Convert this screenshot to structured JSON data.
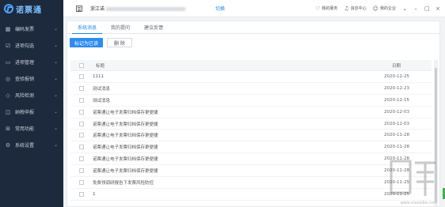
{
  "app": {
    "name": "诺票通"
  },
  "sidebar": {
    "items": [
      {
        "label": "编码发票",
        "icon": "barcode-icon"
      },
      {
        "label": "进项勾选",
        "icon": "checklist-icon"
      },
      {
        "label": "进项管理",
        "icon": "folder-icon"
      },
      {
        "label": "查验报销",
        "icon": "verify-icon"
      },
      {
        "label": "风险检测",
        "icon": "risk-icon"
      },
      {
        "label": "纳税申报",
        "icon": "tax-icon"
      },
      {
        "label": "常用功能",
        "icon": "grid-icon"
      },
      {
        "label": "系统设置",
        "icon": "gear-icon"
      }
    ]
  },
  "topbar": {
    "company_prefix": "浙江诺",
    "switch_label": "切换",
    "service_label": "我的服务",
    "message_label": "消息中心",
    "enterprise_label": "我的企业"
  },
  "tabs": [
    {
      "label": "系统消息",
      "active": true
    },
    {
      "label": "我的提问",
      "active": false
    },
    {
      "label": "建议反馈",
      "active": false
    }
  ],
  "toolbar": {
    "mark_read_label": "标记为已读",
    "delete_label": "删 除"
  },
  "table": {
    "headers": {
      "title": "标题",
      "date": "日期"
    },
    "rows": [
      {
        "title": "1111",
        "date": "2020-12-25"
      },
      {
        "title": "测试消息",
        "date": "2020-12-23"
      },
      {
        "title": "测试消息",
        "date": "2020-12-15"
      },
      {
        "title": "诺票通让电子发票归档保存更便捷",
        "date": "2020-12-03"
      },
      {
        "title": "诺票通让电子发票归档保存更便捷",
        "date": "2020-12-03"
      },
      {
        "title": "诺票通让电子发票归档保存更便捷",
        "date": "2020-11-28"
      },
      {
        "title": "诺票通让电子发票归档保存更便捷",
        "date": "2020-11-28"
      },
      {
        "title": "诺票通让电子发票归档保存更便捷",
        "date": "2020-11-28"
      },
      {
        "title": "诺票通让电子发票归档保存更便捷",
        "date": "2020-11-28"
      },
      {
        "title": "免费领调研报告下发票风险防控",
        "date": "2020-11-25"
      },
      {
        "title": "1",
        "date": "2020-11-25"
      }
    ]
  },
  "watermark": {
    "text": "下载吧",
    "url": "www.xiazaiba.com"
  }
}
